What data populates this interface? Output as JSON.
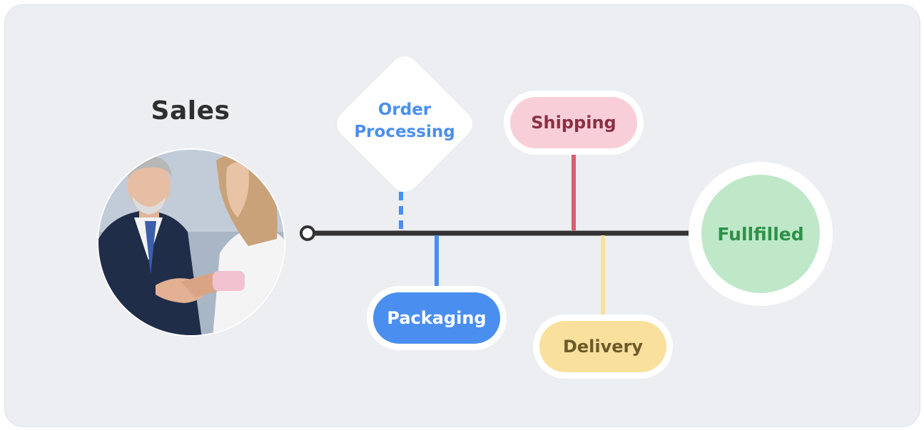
{
  "diagram": {
    "start_label": "Sales",
    "stages": {
      "order_processing": {
        "label": "Order\nProcessing",
        "color": "#4a8ff0",
        "connector": "dashed"
      },
      "shipping": {
        "label": "Shipping",
        "color": "#d66071",
        "fill": "#f8cfd8"
      },
      "packaging": {
        "label": "Packaging",
        "color": "#4a8ff0",
        "fill": "#4a8ff0"
      },
      "delivery": {
        "label": "Delivery",
        "color": "#f9e09c",
        "fill": "#f9e09c"
      },
      "fulfilled": {
        "label": "Fullfilled",
        "color": "#2e9148",
        "fill": "#bfe8c9"
      }
    },
    "photo_icon": "handshake-photo",
    "timeline_color": "#333333",
    "background": "#eceef1"
  }
}
